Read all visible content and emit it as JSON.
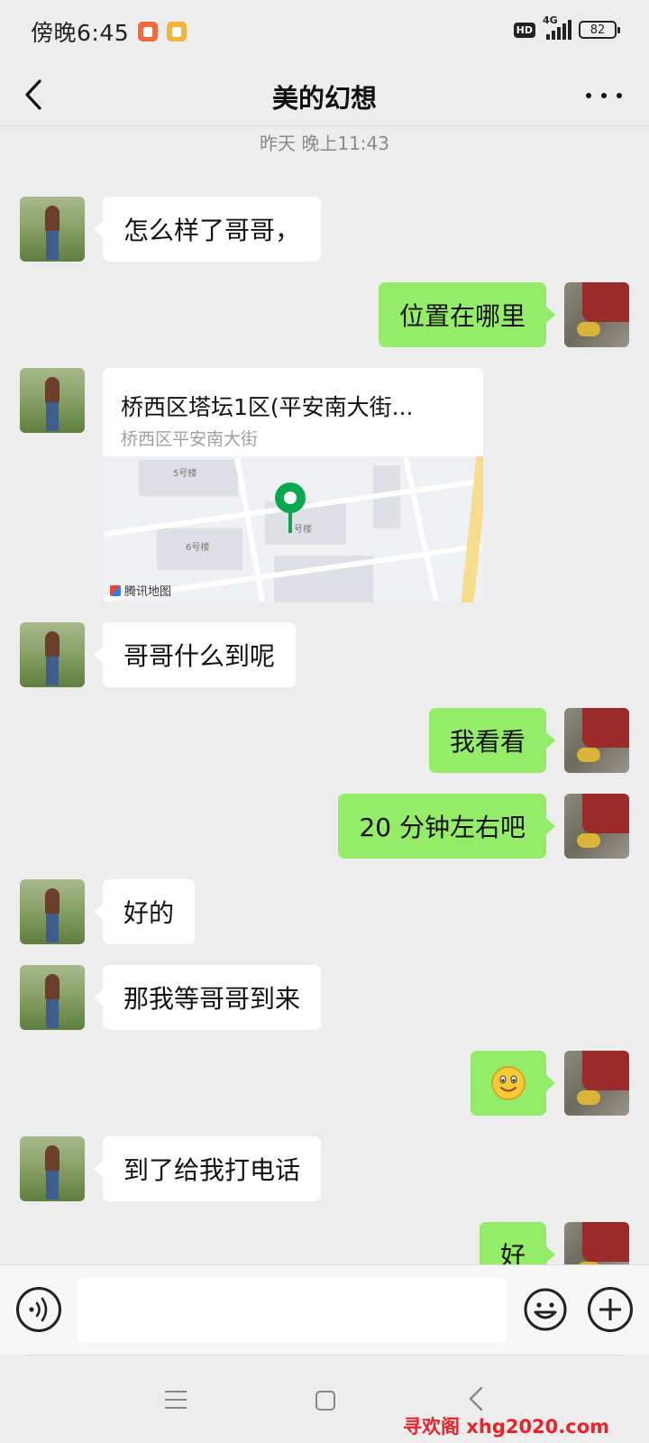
{
  "status_bar": {
    "time": "傍晚6:45",
    "hd": "HD",
    "network": "4G",
    "battery": "82",
    "icons": [
      "app-notification-icon",
      "gallery-notification-icon",
      "signal-icon",
      "battery-icon"
    ]
  },
  "header": {
    "title": "美的幻想",
    "back_icon": "chevron-left-icon",
    "more_icon": "more-dots-icon"
  },
  "timestamp": "昨天 晚上11:43",
  "messages": [
    {
      "from": "them",
      "text": "怎么样了哥哥，"
    },
    {
      "from": "me",
      "text": "位置在哪里"
    },
    {
      "from": "them",
      "type": "location",
      "title": "桥西区塔坛1区(平安南大街...",
      "subtitle": "桥西区平安南大街",
      "map": {
        "labels": [
          "5号楼",
          "6号楼",
          "号楼"
        ],
        "attribution": "腾讯地图"
      }
    },
    {
      "from": "them",
      "text": "哥哥什么到呢"
    },
    {
      "from": "me",
      "text": "我看看"
    },
    {
      "from": "me",
      "text": "20 分钟左右吧"
    },
    {
      "from": "them",
      "text": "好的"
    },
    {
      "from": "them",
      "text": "那我等哥哥到来"
    },
    {
      "from": "me",
      "type": "emoji",
      "emoji": "smile-emoji"
    },
    {
      "from": "them",
      "text": "到了给我打电话"
    },
    {
      "from": "me",
      "text": "好"
    }
  ],
  "input_bar": {
    "placeholder": "",
    "voice_icon": "voice-icon",
    "emoji_icon": "emoji-icon",
    "plus_icon": "plus-icon"
  },
  "nav_bar": {
    "icons": [
      "menu-icon",
      "home-icon",
      "back-icon"
    ]
  },
  "watermark": "寻欢阁 xhg2020.com",
  "colors": {
    "background": "#ededed",
    "outgoing_bubble": "#95ec69",
    "incoming_bubble": "#ffffff",
    "watermark": "#e8232a"
  }
}
